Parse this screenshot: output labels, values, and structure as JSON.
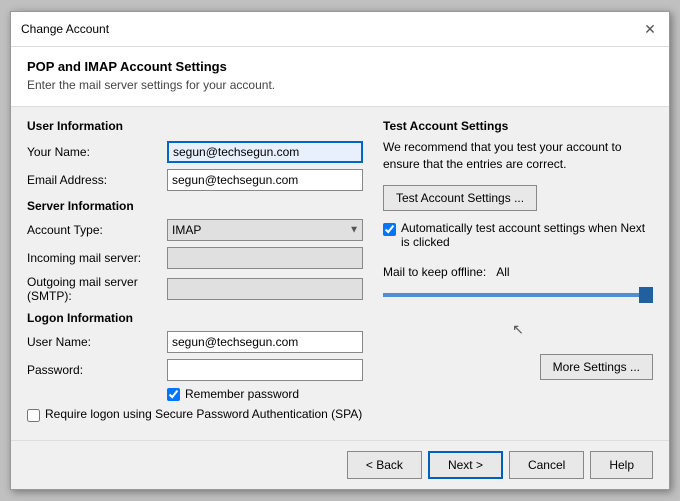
{
  "dialog": {
    "title": "Change Account",
    "close_label": "✕"
  },
  "header": {
    "title": "POP and IMAP Account Settings",
    "subtitle": "Enter the mail server settings for your account."
  },
  "left": {
    "user_information_title": "User Information",
    "your_name_label": "Your Name:",
    "your_name_value": "segun@techsegun.com",
    "email_address_label": "Email Address:",
    "email_address_value": "segun@techsegun.com",
    "server_information_title": "Server Information",
    "account_type_label": "Account Type:",
    "account_type_value": "IMAP",
    "incoming_label": "Incoming mail server:",
    "incoming_value": "",
    "outgoing_label": "Outgoing mail server (SMTP):",
    "outgoing_value": "",
    "logon_information_title": "Logon Information",
    "user_name_label": "User Name:",
    "user_name_value": "segun@techsegun.com",
    "password_label": "Password:",
    "password_value": "",
    "remember_password_label": "Remember password",
    "require_logon_label": "Require logon using Secure Password Authentication (SPA)"
  },
  "right": {
    "test_settings_title": "Test Account Settings",
    "test_description": "We recommend that you test your account to ensure that the entries are correct.",
    "test_button_label": "Test Account Settings ...",
    "auto_test_label": "Automatically test account settings when Next is clicked",
    "offline_label": "Mail to keep offline:",
    "offline_value": "All",
    "more_settings_label": "More Settings ..."
  },
  "footer": {
    "back_label": "< Back",
    "next_label": "Next >",
    "cancel_label": "Cancel",
    "help_label": "Help"
  }
}
